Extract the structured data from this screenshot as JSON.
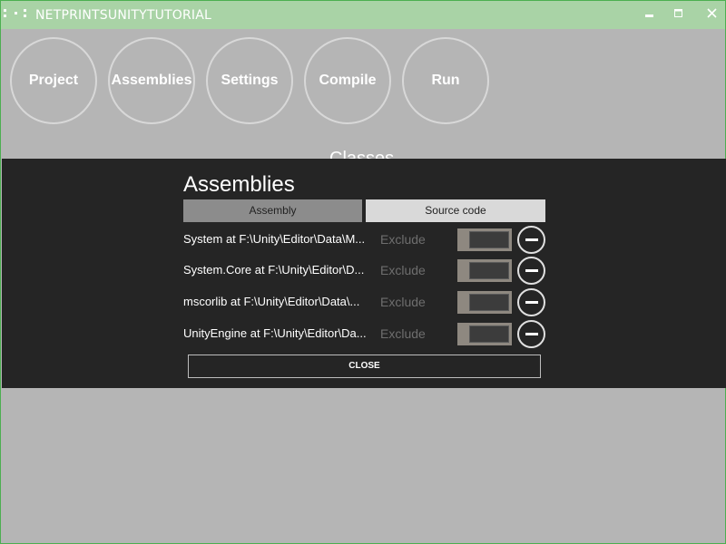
{
  "window": {
    "title": "NETPRINTSUNITYTUTORIAL",
    "controls": [
      "minimize-icon",
      "maximize-icon",
      "close-icon"
    ],
    "accent": "#4caf50",
    "titlebar_color": "#a9d3a6"
  },
  "nav": {
    "buttons": [
      {
        "label": "Project"
      },
      {
        "label": "Assemblies"
      },
      {
        "label": "Settings"
      },
      {
        "label": "Compile"
      },
      {
        "label": "Run"
      }
    ]
  },
  "background_heading": "Classes",
  "dialog": {
    "title": "Assemblies",
    "tabs": [
      {
        "label": "Assembly",
        "active": true
      },
      {
        "label": "Source code",
        "active": false
      }
    ],
    "rows": [
      {
        "label": "System at F:\\Unity\\Editor\\Data\\M...",
        "exclude_label": "Exclude",
        "excluded": false
      },
      {
        "label": "System.Core at F:\\Unity\\Editor\\D...",
        "exclude_label": "Exclude",
        "excluded": false
      },
      {
        "label": "mscorlib at F:\\Unity\\Editor\\Data\\...",
        "exclude_label": "Exclude",
        "excluded": false
      },
      {
        "label": "UnityEngine at F:\\Unity\\Editor\\Da...",
        "exclude_label": "Exclude",
        "excluded": false
      }
    ],
    "close_label": "CLOSE"
  }
}
